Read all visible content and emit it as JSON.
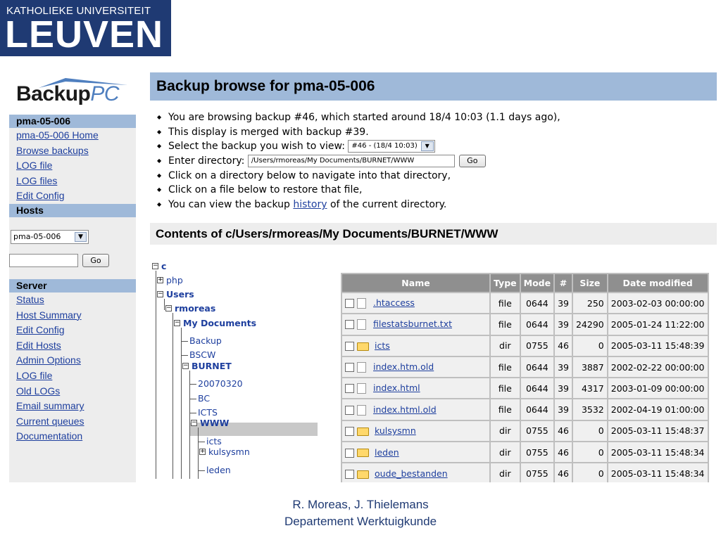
{
  "logo": {
    "line1": "KATHOLIEKE UNIVERSITEIT",
    "line2": "LEUVEN"
  },
  "app_logo": {
    "word": "ackup",
    "b": "B",
    "pc": "PC"
  },
  "nav": {
    "host_header": "pma-05-006",
    "host_links": [
      "pma-05-006 Home",
      "Browse backups",
      "LOG file",
      "LOG files",
      "Edit Config"
    ],
    "hosts_header": "Hosts",
    "host_select_value": "pma-05-006",
    "go_label": "Go",
    "server_header": "Server",
    "server_links": [
      "Status",
      "Host Summary",
      "Edit Config",
      "Edit Hosts",
      "Admin Options",
      "LOG file",
      "Old LOGs",
      "Email summary",
      "Current queues",
      "Documentation"
    ]
  },
  "main": {
    "title": "Backup browse for pma-05-006",
    "info_lines": {
      "l1": "You are browsing backup #46, which started around 18/4 10:03 (1.1 days ago),",
      "l2": "This display is merged with backup #39.",
      "l3": "Select the backup you wish to view:",
      "l3_select": "#46 - (18/4 10:03)",
      "l4": "Enter directory:",
      "l4_input": "/Users/rmoreas/My Documents/BURNET/WWW",
      "l4_go": "Go",
      "l5": "Click on a directory below to navigate into that directory,",
      "l6": "Click on a file below to restore that file,",
      "l7_pre": "You can view the backup",
      "l7_link": "history",
      "l7_post": "of the current directory."
    },
    "contents_title": "Contents of c/Users/rmoreas/My Documents/BURNET/WWW"
  },
  "tree": {
    "c": "c",
    "php": "php",
    "users": "Users",
    "rmoreas": "rmoreas",
    "mydocs": "My Documents",
    "backup": "Backup",
    "bscw": "BSCW",
    "burnet": "BURNET",
    "d20070320": "20070320",
    "bc": "BC",
    "icts_upper": "ICTS",
    "www": "WWW",
    "icts": "icts",
    "kulsysmn": "kulsysmn",
    "leden": "leden"
  },
  "table": {
    "headers": [
      "Name",
      "Type",
      "Mode",
      "#",
      "Size",
      "Date modified"
    ],
    "rows": [
      {
        "name": ".htaccess",
        "type": "file",
        "mode": "0644",
        "num": "39",
        "size": "250",
        "date": "2003-02-03 00:00:00"
      },
      {
        "name": "filestatsburnet.txt",
        "type": "file",
        "mode": "0644",
        "num": "39",
        "size": "24290",
        "date": "2005-01-24 11:22:00"
      },
      {
        "name": "icts",
        "type": "dir",
        "mode": "0755",
        "num": "46",
        "size": "0",
        "date": "2005-03-11 15:48:39"
      },
      {
        "name": "index.htm.old",
        "type": "file",
        "mode": "0644",
        "num": "39",
        "size": "3887",
        "date": "2002-02-22 00:00:00"
      },
      {
        "name": "index.html",
        "type": "file",
        "mode": "0644",
        "num": "39",
        "size": "4317",
        "date": "2003-01-09 00:00:00"
      },
      {
        "name": "index.html.old",
        "type": "file",
        "mode": "0644",
        "num": "39",
        "size": "3532",
        "date": "2002-04-19 01:00:00"
      },
      {
        "name": "kulsysmn",
        "type": "dir",
        "mode": "0755",
        "num": "46",
        "size": "0",
        "date": "2005-03-11 15:48:37"
      },
      {
        "name": "leden",
        "type": "dir",
        "mode": "0755",
        "num": "46",
        "size": "0",
        "date": "2005-03-11 15:48:34"
      },
      {
        "name": "oude_bestanden",
        "type": "dir",
        "mode": "0755",
        "num": "46",
        "size": "0",
        "date": "2005-03-11 15:48:34"
      }
    ]
  },
  "footer": {
    "line1": "R. Moreas, J. Thielemans",
    "line2": "Departement Werktuigkunde"
  }
}
